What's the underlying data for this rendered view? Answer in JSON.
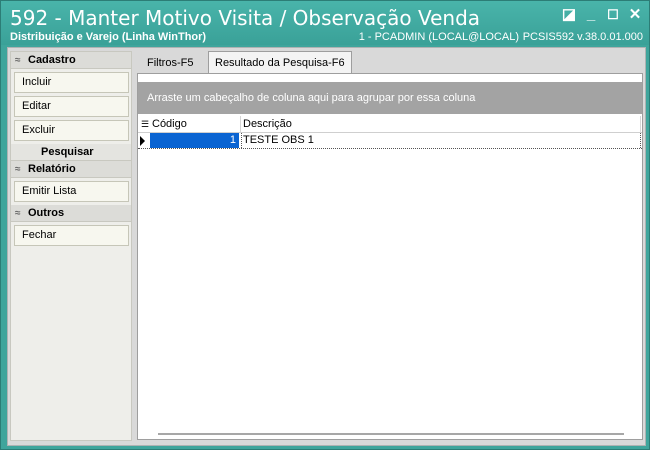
{
  "window": {
    "title": "592 - Manter Motivo Visita / Observação Venda",
    "subtitle": "Distribuição e Varejo (Linha WinThor)",
    "user_info": "1 - PCADMIN (LOCAL@LOCAL)",
    "version": "PCSIS592  v.38.0.01.000",
    "buttons": {
      "restore": "◪",
      "minimize": "_",
      "maximize": "☐",
      "close": "✕"
    }
  },
  "sidebar": {
    "cadastro": {
      "label": "Cadastro",
      "items": [
        "Incluir",
        "Editar",
        "Excluir"
      ]
    },
    "pesquisar": {
      "label": "Pesquisar"
    },
    "relatorio": {
      "label": "Relatório",
      "items": [
        "Emitir Lista"
      ]
    },
    "outros": {
      "label": "Outros",
      "items": [
        "Fechar"
      ]
    }
  },
  "tabs": [
    "Filtros-F5",
    "Resultado da Pesquisa-F6"
  ],
  "active_tab": "Resultado da Pesquisa-F6",
  "grid": {
    "group_hint": "Arraste um cabeçalho de coluna aqui para agrupar por essa coluna",
    "columns": [
      "Código",
      "Descrição"
    ],
    "rows": [
      {
        "codigo": "1",
        "descricao": "TESTE OBS 1"
      }
    ]
  },
  "colors": {
    "titlebar": "#3fa59c",
    "selection": "#0a64d2",
    "group_panel": "#a3a3a3"
  }
}
